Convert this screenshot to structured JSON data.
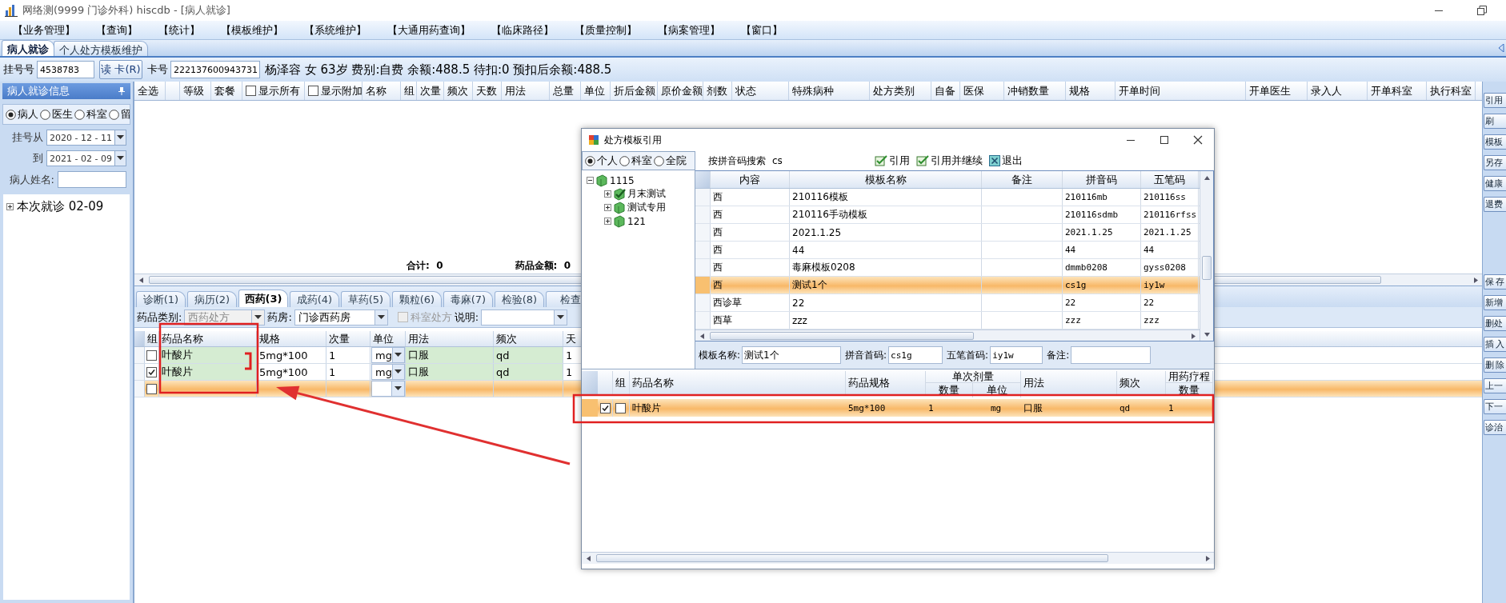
{
  "window": {
    "title": "网络测(9999 门诊外科)  hiscdb - [病人就诊]"
  },
  "menu": [
    "【业务管理】",
    "【查询】",
    "【统计】",
    "【模板维护】",
    "【系统维护】",
    "【大通用药查询】",
    "【临床路径】",
    "【质量控制】",
    "【病案管理】",
    "【窗口】"
  ],
  "doc_tabs": [
    {
      "label": "病人就诊",
      "selected": true
    },
    {
      "label": "个人处方模板维护",
      "selected": false
    }
  ],
  "patient_bar": {
    "reg_label": "挂号号",
    "reg_no": "4538783",
    "read_card": "读 卡(R)",
    "card_label": "卡号",
    "card_no": "222137600943731",
    "summary": "杨泽容 女 63岁 费别:自费 余额:488.5 待扣:0 预扣后余额:488.5"
  },
  "visit_panel": {
    "title": "病人就诊信息",
    "filters": [
      {
        "label": "病人",
        "selected": true
      },
      {
        "label": "医生",
        "selected": false
      },
      {
        "label": "科室",
        "selected": false
      },
      {
        "label": "留",
        "selected": false
      }
    ],
    "date_from": {
      "label": "挂号从",
      "value": "2020 - 12 - 11"
    },
    "date_to": {
      "label": "到",
      "value": "2021 - 02 - 09"
    },
    "name_label": "病人姓名:",
    "visits": [
      {
        "label": "本次就诊 02-09",
        "expanded": false
      }
    ]
  },
  "order_grid": {
    "columns": [
      {
        "kind": "text",
        "label": "全选"
      },
      {
        "kind": "text",
        "label": "等级"
      },
      {
        "kind": "text",
        "label": "套餐"
      },
      {
        "kind": "toggle",
        "label": "显示所有",
        "checked": false
      },
      {
        "kind": "toggle",
        "label": "显示附加",
        "checked": false
      },
      {
        "kind": "text",
        "label": "名称"
      },
      {
        "kind": "text",
        "label": "组"
      },
      {
        "kind": "text",
        "label": "次量"
      },
      {
        "kind": "text",
        "label": "频次"
      },
      {
        "kind": "text",
        "label": "天数"
      },
      {
        "kind": "text",
        "label": "用法"
      },
      {
        "kind": "text",
        "label": "总量"
      },
      {
        "kind": "text",
        "label": "单位"
      },
      {
        "kind": "text",
        "label": "折后金额"
      },
      {
        "kind": "text",
        "label": "原价金额"
      },
      {
        "kind": "text",
        "label": "剂数"
      },
      {
        "kind": "text",
        "label": "状态"
      },
      {
        "kind": "text",
        "label": "特殊病种"
      },
      {
        "kind": "text",
        "label": "处方类别"
      },
      {
        "kind": "text",
        "label": "自备"
      },
      {
        "kind": "text",
        "label": "医保"
      },
      {
        "kind": "text",
        "label": "冲销数量"
      },
      {
        "kind": "text",
        "label": "规格"
      },
      {
        "kind": "text",
        "label": "开单时间"
      },
      {
        "kind": "text",
        "label": "开单医生"
      },
      {
        "kind": "text",
        "label": "录入人"
      },
      {
        "kind": "text",
        "label": "开单科室"
      },
      {
        "kind": "text",
        "label": "执行科室"
      }
    ],
    "totals": [
      "合计:  0",
      "药品金额:  0"
    ]
  },
  "rx_tabs": [
    {
      "label": "诊断(1)",
      "selected": false
    },
    {
      "label": "病历(2)",
      "selected": false
    },
    {
      "label": "西药(3)",
      "selected": true
    },
    {
      "label": "成药(4)",
      "selected": false
    },
    {
      "label": "草药(5)",
      "selected": false
    },
    {
      "label": "颗粒(6)",
      "selected": false
    },
    {
      "label": "毒麻(7)",
      "selected": false
    },
    {
      "label": "检验(8)",
      "selected": false
    },
    {
      "label": "检查",
      "selected": false
    }
  ],
  "rx_filter": {
    "category_label": "药品类别:",
    "category": "西药处方",
    "category_disabled": true,
    "pharmacy_label": "药房:",
    "pharmacy": "门诊西药房",
    "dept_rx": {
      "label": "科室处方",
      "checked": false,
      "disabled": true
    },
    "note_label": "说明:"
  },
  "rx_grid": {
    "columns": [
      "组",
      "药品名称",
      "规格",
      "次量",
      "单位",
      "用法",
      "频次",
      "天"
    ],
    "rows": [
      {
        "group": false,
        "name": "叶酸片",
        "spec": "5mg*100",
        "dose": "1",
        "unit": "mg",
        "usage": "口服",
        "freq": "qd",
        "days": "1",
        "selected": false
      },
      {
        "group": true,
        "name": "叶酸片",
        "spec": "5mg*100",
        "dose": "1",
        "unit": "mg",
        "usage": "口服",
        "freq": "qd",
        "days": "1",
        "selected": false
      },
      {
        "group": false,
        "selected": true
      }
    ]
  },
  "side_buttons_top": [
    "引用",
    "刷",
    "模板",
    "另存",
    "健康",
    "退费"
  ],
  "side_buttons_bottom": [
    "保 存",
    "新增",
    "删处",
    "插 入",
    "删 除",
    "上一",
    "下一",
    "诊治"
  ],
  "template_dialog": {
    "title": "处方模板引用",
    "scopes": [
      {
        "label": "个人",
        "selected": true
      },
      {
        "label": "科室",
        "selected": false
      },
      {
        "label": "全院",
        "selected": false
      }
    ],
    "search_label": "按拼音码搜索",
    "search": "cs",
    "actions": [
      {
        "kind": "check",
        "label": "引用"
      },
      {
        "kind": "check",
        "label": "引用并继续"
      },
      {
        "kind": "exit",
        "label": "退出"
      }
    ],
    "tree": [
      {
        "label": "1115",
        "kind": "book",
        "expanded": true,
        "children": [
          {
            "label": "月末测试",
            "kind": "checked",
            "expanded": false
          },
          {
            "label": "测试专用",
            "kind": "book",
            "expanded": false
          },
          {
            "label": "121",
            "kind": "book",
            "expanded": false
          }
        ]
      }
    ],
    "templates": {
      "columns": [
        "内容",
        "模板名称",
        "备注",
        "拼音码",
        "五笔码"
      ],
      "rows": [
        {
          "content": "西",
          "name": "210116模板",
          "pinyin": "210116mb",
          "wubi": "210116ss",
          "selected": false
        },
        {
          "content": "西",
          "name": "210116手动模板",
          "pinyin": "210116sdmb",
          "wubi": "210116rfss",
          "selected": false
        },
        {
          "content": "西",
          "name": "2021.1.25",
          "pinyin": "2021.1.25",
          "wubi": "2021.1.25",
          "selected": false
        },
        {
          "content": "西",
          "name": "44",
          "pinyin": "44",
          "wubi": "44",
          "selected": false
        },
        {
          "content": "西",
          "name": "毒麻模板0208",
          "pinyin": "dmmb0208",
          "wubi": "gyss0208",
          "selected": false
        },
        {
          "content": "西",
          "name": "测试1个",
          "pinyin": "cs1g",
          "wubi": "iy1w",
          "selected": true
        },
        {
          "content": "西诊草",
          "name": "22",
          "pinyin": "22",
          "wubi": "22",
          "selected": false
        },
        {
          "content": "西草",
          "name": "zzz",
          "pinyin": "zzz",
          "wubi": "zzz",
          "selected": false
        }
      ]
    },
    "fields": [
      {
        "label": "模板名称:",
        "value": "测试1个"
      },
      {
        "label": "拼音首码:",
        "value": "cs1g"
      },
      {
        "label": "五笔首码:",
        "value": "iy1w"
      },
      {
        "label": "备注:"
      }
    ],
    "items": {
      "columns": [
        {
          "label": "组"
        },
        {
          "label": "药品名称"
        },
        {
          "label": "药品规格"
        },
        {
          "label": "单次剂量",
          "children": [
            "数量",
            "单位"
          ]
        },
        {
          "label": "用法"
        },
        {
          "label": "频次"
        },
        {
          "label": "用药疗程",
          "children": [
            "数量"
          ]
        }
      ],
      "rows": [
        {
          "checked": true,
          "group": false,
          "name": "叶酸片",
          "spec": "5mg*100",
          "qty": "1",
          "unit": "mg",
          "usage": "口服",
          "freq": "qd",
          "course": "1",
          "selected": true
        }
      ]
    }
  }
}
